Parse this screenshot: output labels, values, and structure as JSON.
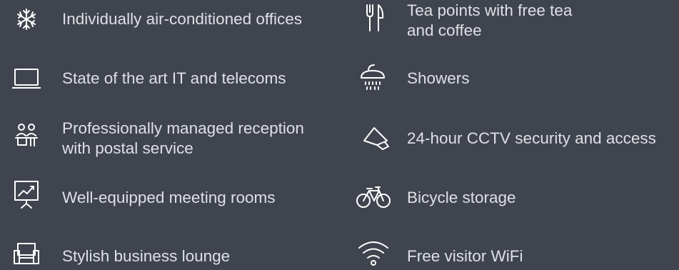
{
  "features": {
    "left": [
      {
        "icon": "snowflake-icon",
        "lines": [
          "Individually air-conditioned offices"
        ]
      },
      {
        "icon": "laptop-icon",
        "lines": [
          "State of the art IT and telecoms"
        ]
      },
      {
        "icon": "reception-icon",
        "lines": [
          "Professionally managed reception",
          "with postal service"
        ]
      },
      {
        "icon": "presentation-board-icon",
        "lines": [
          "Well-equipped meeting rooms"
        ]
      },
      {
        "icon": "sofa-icon",
        "lines": [
          "Stylish business lounge"
        ]
      }
    ],
    "right": [
      {
        "icon": "cutlery-icon",
        "lines": [
          "Tea points with free tea",
          "and coffee"
        ]
      },
      {
        "icon": "shower-icon",
        "lines": [
          "Showers"
        ]
      },
      {
        "icon": "cctv-camera-icon",
        "lines": [
          "24-hour CCTV security and access"
        ]
      },
      {
        "icon": "bicycle-icon",
        "lines": [
          "Bicycle storage"
        ]
      },
      {
        "icon": "wifi-icon",
        "lines": [
          "Free visitor WiFi"
        ]
      }
    ]
  },
  "colors": {
    "background": "#40444e",
    "text": "#dde0e5",
    "icon": "#ffffff"
  }
}
